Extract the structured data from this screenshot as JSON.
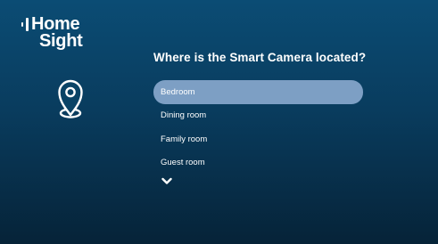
{
  "app": {
    "logo_word1": "Home",
    "logo_word2": "Sight"
  },
  "question": "Where is the Smart Camera located?",
  "rooms": [
    {
      "label": "Bedroom",
      "selected": true
    },
    {
      "label": "Dining room",
      "selected": false
    },
    {
      "label": "Family room",
      "selected": false
    },
    {
      "label": "Guest room",
      "selected": false
    }
  ],
  "icons": {
    "location": "location-pin-icon",
    "more": "chevron-down-icon"
  },
  "colors": {
    "background_top": "#0b4c74",
    "background_bottom": "#062338",
    "selected_item": "#7d9fc4",
    "text": "#ffffff"
  }
}
